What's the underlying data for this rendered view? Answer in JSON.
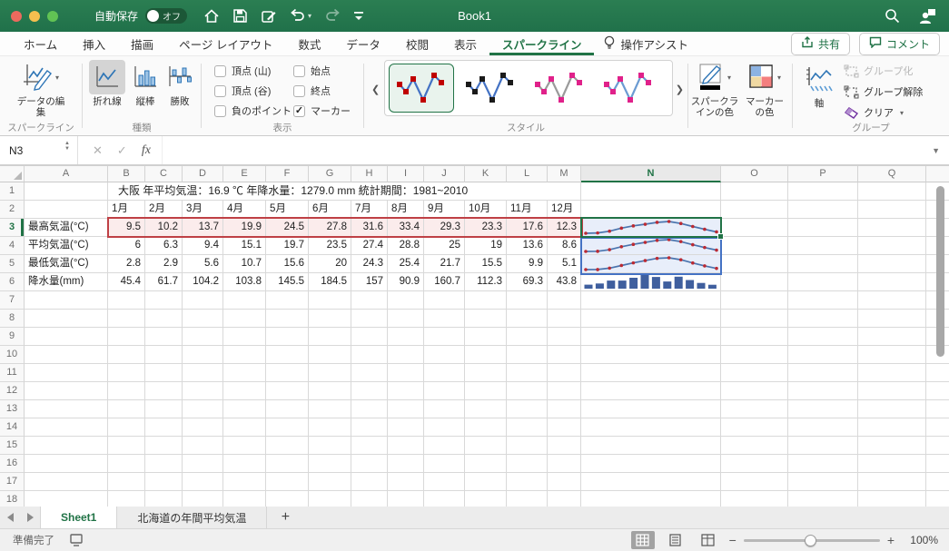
{
  "titlebar": {
    "autosave_label": "自動保存",
    "autosave_state": "オフ",
    "title": "Book1"
  },
  "tabs": {
    "items": [
      "ホーム",
      "挿入",
      "描画",
      "ページ レイアウト",
      "数式",
      "データ",
      "校閲",
      "表示",
      "スパークライン"
    ],
    "active": "スパークライン",
    "assist": "操作アシスト",
    "share": "共有",
    "comment": "コメント"
  },
  "ribbon": {
    "group_labels": {
      "sparkline": "スパークライン",
      "type": "種類",
      "show": "表示",
      "style": "スタイル",
      "group": "グループ"
    },
    "edit_data": "データの編集",
    "type_buttons": {
      "line": "折れ線",
      "column": "縦棒",
      "winloss": "勝敗"
    },
    "checkboxes": [
      {
        "label": "頂点 (山)",
        "checked": false
      },
      {
        "label": "頂点 (谷)",
        "checked": false
      },
      {
        "label": "負のポイント",
        "checked": false
      },
      {
        "label": "始点",
        "checked": false
      },
      {
        "label": "終点",
        "checked": false
      },
      {
        "label": "マーカー",
        "checked": true
      }
    ],
    "styles": [
      {
        "line": "#4472c4",
        "marker": "#c00000",
        "selected": true
      },
      {
        "line": "#4472c4",
        "marker": "#1a1a1a",
        "selected": false
      },
      {
        "line": "#9a9a9a",
        "marker": "#e0218a",
        "selected": false
      },
      {
        "line": "#6b9bd2",
        "marker": "#e0218a",
        "selected": false
      }
    ],
    "color_buttons": {
      "sparkline_color": "スパークラインの色",
      "marker_color": "マーカーの色"
    },
    "group_buttons": {
      "axis": "軸",
      "group": "グループ化",
      "ungroup": "グループ解除",
      "clear": "クリア"
    }
  },
  "formula_bar": {
    "cell_ref": "N3",
    "fx_label": "fx"
  },
  "sheet": {
    "columns": [
      "A",
      "B",
      "C",
      "D",
      "E",
      "F",
      "G",
      "H",
      "I",
      "J",
      "K",
      "L",
      "M",
      "N",
      "O",
      "P",
      "Q"
    ],
    "visible_rows": 18,
    "title_row": "大阪 年平均気温：16.9 ℃ 年降水量：1279.0 mm 統計期間：1981~2010",
    "months": [
      "1月",
      "2月",
      "3月",
      "4月",
      "5月",
      "6月",
      "7月",
      "8月",
      "9月",
      "10月",
      "11月",
      "12月"
    ],
    "rows": [
      {
        "label": "最高気温(°C)",
        "values": [
          9.5,
          10.2,
          13.7,
          19.9,
          24.5,
          27.8,
          31.6,
          33.4,
          29.3,
          23.3,
          17.6,
          12.3
        ]
      },
      {
        "label": "平均気温(°C)",
        "values": [
          6,
          6.3,
          9.4,
          15.1,
          19.7,
          23.5,
          27.4,
          28.8,
          25,
          19,
          13.6,
          8.6
        ]
      },
      {
        "label": "最低気温(°C)",
        "values": [
          2.8,
          2.9,
          5.6,
          10.7,
          15.6,
          20,
          24.3,
          25.4,
          21.7,
          15.5,
          9.9,
          5.1
        ]
      },
      {
        "label": "降水量(mm)",
        "values": [
          45.4,
          61.7,
          104.2,
          103.8,
          145.5,
          184.5,
          157,
          90.9,
          160.7,
          112.3,
          69.3,
          43.8
        ]
      }
    ],
    "selection": {
      "active_cell": "N3",
      "data_range": "B3:M3",
      "sparkline_group": "N3:N5"
    }
  },
  "chart_data": [
    {
      "type": "line",
      "title": "最高気温(°C) スパークライン (セル N3)",
      "x": [
        "1月",
        "2月",
        "3月",
        "4月",
        "5月",
        "6月",
        "7月",
        "8月",
        "9月",
        "10月",
        "11月",
        "12月"
      ],
      "values": [
        9.5,
        10.2,
        13.7,
        19.9,
        24.5,
        27.8,
        31.6,
        33.4,
        29.3,
        23.3,
        17.6,
        12.3
      ],
      "line_color": "#4a74ae",
      "marker_color": "#bb2a33"
    },
    {
      "type": "line",
      "title": "平均気温(°C) スパークライン (セル N4)",
      "x": [
        "1月",
        "2月",
        "3月",
        "4月",
        "5月",
        "6月",
        "7月",
        "8月",
        "9月",
        "10月",
        "11月",
        "12月"
      ],
      "values": [
        6,
        6.3,
        9.4,
        15.1,
        19.7,
        23.5,
        27.4,
        28.8,
        25,
        19,
        13.6,
        8.6
      ],
      "line_color": "#4a74ae",
      "marker_color": "#bb2a33"
    },
    {
      "type": "line",
      "title": "最低気温(°C) スパークライン (セル N5)",
      "x": [
        "1月",
        "2月",
        "3月",
        "4月",
        "5月",
        "6月",
        "7月",
        "8月",
        "9月",
        "10月",
        "11月",
        "12月"
      ],
      "values": [
        2.8,
        2.9,
        5.6,
        10.7,
        15.6,
        20,
        24.3,
        25.4,
        21.7,
        15.5,
        9.9,
        5.1
      ],
      "line_color": "#4a74ae",
      "marker_color": "#bb2a33"
    },
    {
      "type": "bar",
      "title": "降水量(mm) スパークライン (セル N6)",
      "x": [
        "1月",
        "2月",
        "3月",
        "4月",
        "5月",
        "6月",
        "7月",
        "8月",
        "9月",
        "10月",
        "11月",
        "12月"
      ],
      "values": [
        45.4,
        61.7,
        104.2,
        103.8,
        145.5,
        184.5,
        157,
        90.9,
        160.7,
        112.3,
        69.3,
        43.8
      ],
      "bar_color": "#3f5f9e"
    }
  ],
  "sheet_tabs": {
    "tabs": [
      {
        "label": "Sheet1",
        "active": true
      },
      {
        "label": "北海道の年間平均気温",
        "active": false
      }
    ],
    "add": "+"
  },
  "status_bar": {
    "ready": "準備完了",
    "zoom_level": "100%"
  },
  "colors": {
    "excel_green": "#217346",
    "selection_red": "#bf4045",
    "selection_blue": "#4472c4",
    "spark_cell_bg": "#e8eefa",
    "data_range_fill": "#fbecec"
  }
}
